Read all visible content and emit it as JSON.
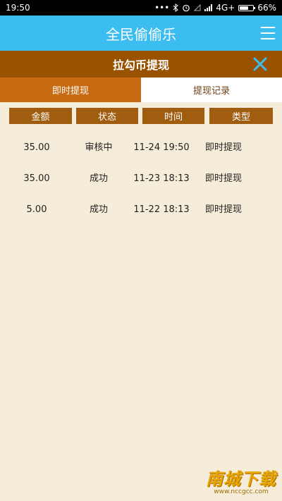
{
  "status_bar": {
    "time": "19:50",
    "dots": "•••",
    "network": "4G+",
    "battery": "66%",
    "battery_level": 0.66
  },
  "app": {
    "title": "全民偷偷乐"
  },
  "dialog": {
    "title": "拉勾币提现"
  },
  "tabs": [
    {
      "label": "即时提现",
      "active": false
    },
    {
      "label": "提现记录",
      "active": true
    }
  ],
  "table": {
    "headers": [
      "金额",
      "状态",
      "时间",
      "类型"
    ],
    "rows": [
      {
        "amount": "35.00",
        "status": "审核中",
        "time": "11-24 19:50",
        "type": "即时提现"
      },
      {
        "amount": "35.00",
        "status": "成功",
        "time": "11-23 18:13",
        "type": "即时提现"
      },
      {
        "amount": "5.00",
        "status": "成功",
        "time": "11-22 18:13",
        "type": "即时提现"
      }
    ]
  },
  "watermark": {
    "main": "南城下载",
    "url": "www.nccgcc.com"
  },
  "colors": {
    "app_bar": "#3bbdf0",
    "dialog_header": "#995200",
    "tab_inactive": "#c86a12",
    "header_cell": "#a05c0f",
    "background": "#f5edd9"
  }
}
